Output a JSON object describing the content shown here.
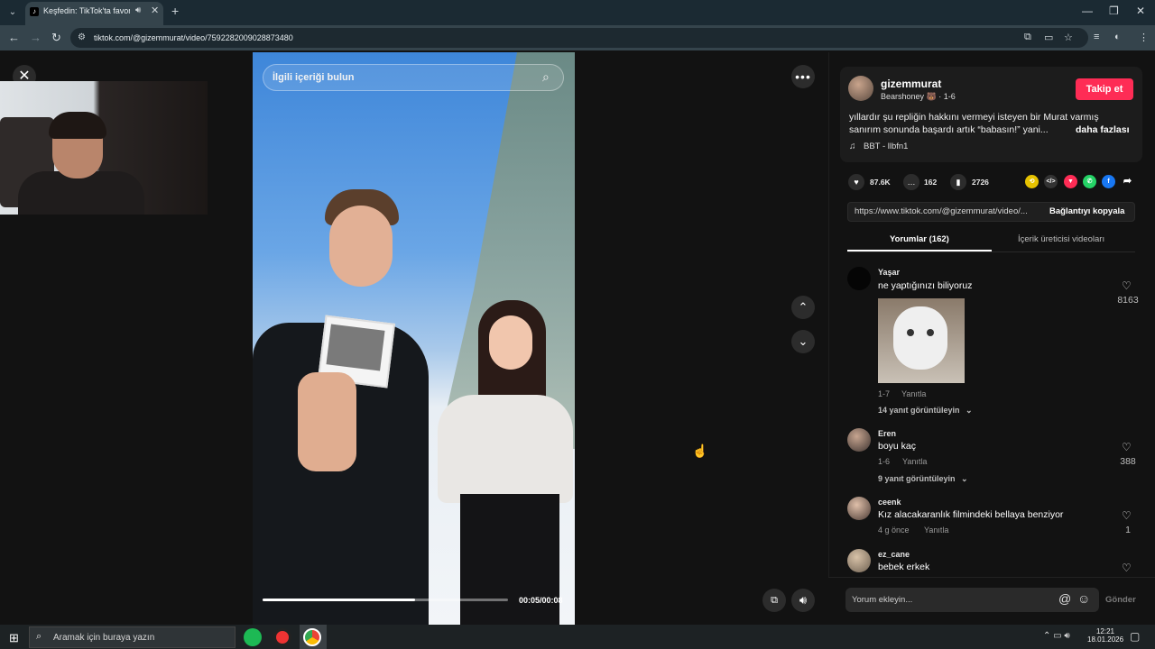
{
  "browser": {
    "tab_title": "Keşfedin: TikTok'ta favori vi",
    "url": "tiktok.com/@gizemmurat/video/7592282009028873480"
  },
  "video": {
    "search_placeholder": "İlgili içeriği bulun",
    "time": "00:05/00:08",
    "progress": 0.62
  },
  "author": {
    "username": "gizemmurat",
    "subtitle": "Bearshoney 🐻 · 1-6",
    "follow_label": "Takip et"
  },
  "description": {
    "line1": "yıllardır şu repliğin hakkını vermeyi isteyen bir Murat varmış",
    "line2": "sanırım sonunda başardı artık “babasın!” yani...",
    "more_label": "daha fazlası",
    "music": "BBT - llbfn1"
  },
  "stats": {
    "likes": "87.6K",
    "comments": "162",
    "saves": "2726"
  },
  "share": {
    "link": "https://www.tiktok.com/@gizemmurat/video/...",
    "copy_label": "Bağlantıyı kopyala"
  },
  "tabs": {
    "comments": "Yorumlar (162)",
    "creator_videos": "İçerik üreticisi videoları"
  },
  "comments": [
    {
      "user": "Yaşar",
      "text": "ne yaptığınızı biliyoruz",
      "date": "1-7",
      "reply": "Yanıtla",
      "views": "14 yanıt görüntüleyin",
      "likes": "8163"
    },
    {
      "user": "Eren",
      "text": "boyu kaç",
      "date": "1-6",
      "reply": "Yanıtla",
      "views": "9 yanıt görüntüleyin",
      "likes": "388"
    },
    {
      "user": "ceenk",
      "text": "Kız alacakaranlık filmindeki bellaya benziyor",
      "date": "4 g önce",
      "reply": "Yanıtla",
      "likes": "1"
    },
    {
      "user": "ez_cane",
      "text": "bebek erkek"
    }
  ],
  "comment_input": {
    "placeholder": "Yorum ekleyin...",
    "send_label": "Gönder"
  },
  "taskbar": {
    "search_placeholder": "Aramak için buraya yazın",
    "time": "12:21",
    "date": "18.01.2026"
  }
}
